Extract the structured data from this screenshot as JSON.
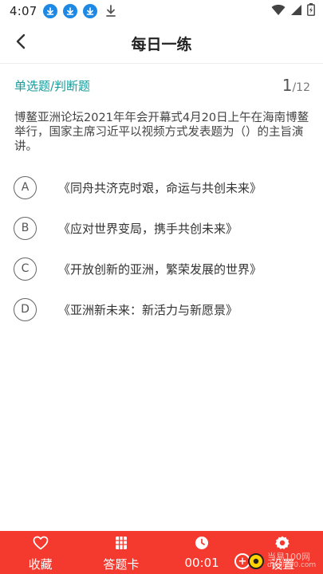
{
  "status_bar": {
    "time": "4:07",
    "icons": [
      "download-badge-icon",
      "download-badge-icon",
      "download-badge-icon",
      "download-icon",
      "wifi-icon",
      "signal-icon",
      "battery-icon"
    ]
  },
  "header": {
    "back_icon": "chevron-left-icon",
    "title": "每日一练"
  },
  "question": {
    "type_label": "单选题/判断题",
    "current": "1",
    "total": "/12",
    "text": "博鳌亚洲论坛2021年年会开幕式4月20日上午在海南博鳌举行，国家主席习近平以视频方式发表题为（）的主旨演讲。",
    "options": [
      {
        "letter": "A",
        "text": "《同舟共济克时艰，命运与共创未来》"
      },
      {
        "letter": "B",
        "text": "《应对世界变局，携手共创未来》"
      },
      {
        "letter": "C",
        "text": "《开放创新的亚洲，繁荣发展的世界》"
      },
      {
        "letter": "D",
        "text": "《亚洲新未来：新活力与新愿景》"
      }
    ]
  },
  "bottom_bar": {
    "background": "#f4392e",
    "tabs": [
      {
        "icon": "heart-icon",
        "label": "收藏"
      },
      {
        "icon": "answer-card-icon",
        "label": "答题卡"
      },
      {
        "icon": "clock-icon",
        "label": "00:01"
      },
      {
        "icon": "settings-gear-icon",
        "label": "设置"
      }
    ]
  },
  "watermark": {
    "line1": "当易100网",
    "line2": "danji100.com"
  },
  "colors": {
    "accent_teal": "#1a9a9a",
    "brand_red": "#f4392e",
    "status_blue": "#1e88e5"
  }
}
